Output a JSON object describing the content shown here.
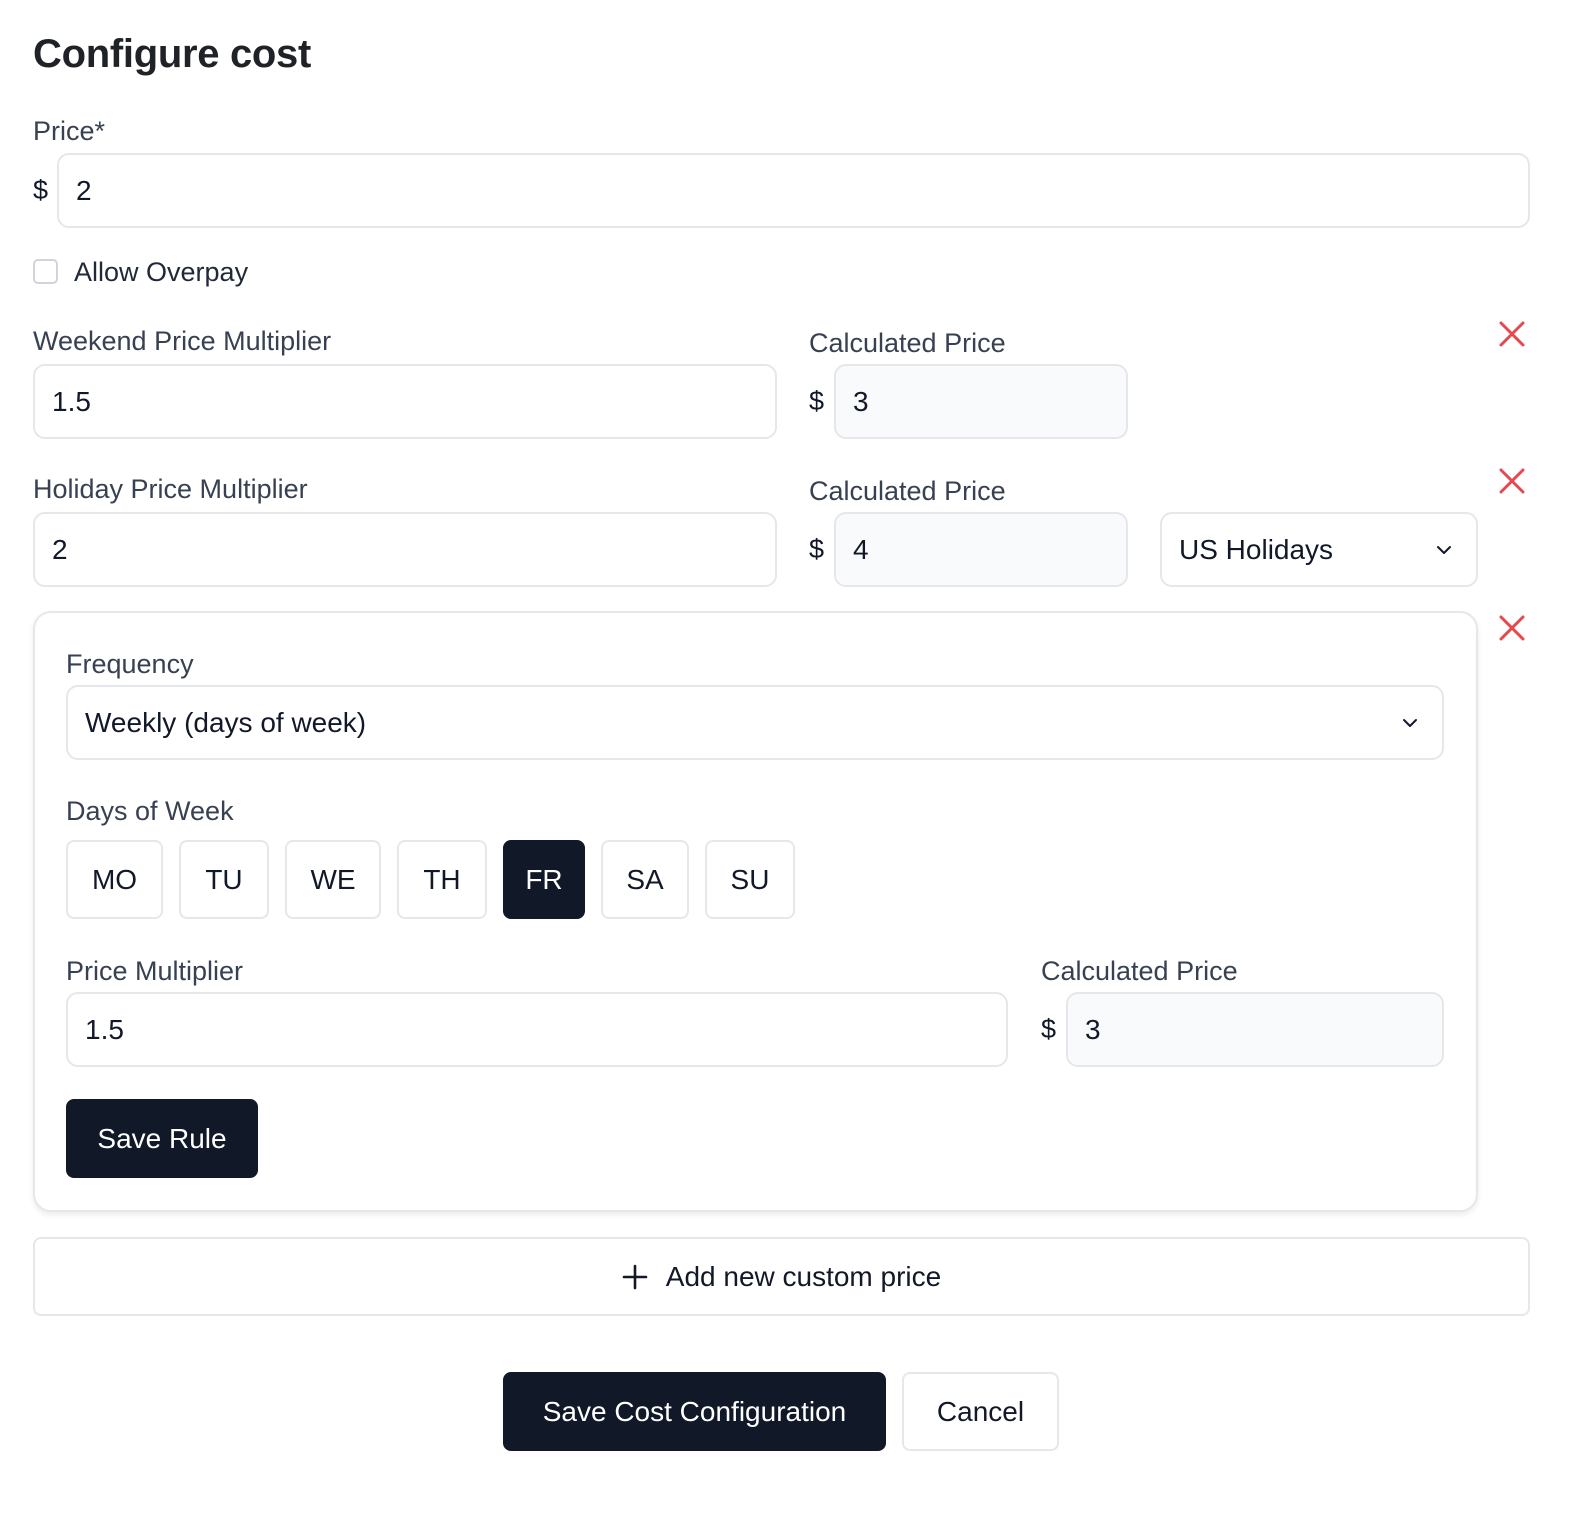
{
  "title": "Configure cost",
  "price": {
    "label": "Price*",
    "currency": "$",
    "value": "2"
  },
  "allow_overpay": {
    "label": "Allow Overpay",
    "checked": false
  },
  "weekend": {
    "label": "Weekend Price Multiplier",
    "value": "1.5",
    "calc_label": "Calculated Price",
    "currency": "$",
    "calc_value": "3"
  },
  "holiday": {
    "label": "Holiday Price Multiplier",
    "value": "2",
    "calc_label": "Calculated Price",
    "currency": "$",
    "calc_value": "4",
    "calendar": "US Holidays"
  },
  "rule": {
    "frequency_label": "Frequency",
    "frequency_value": "Weekly (days of week)",
    "days_label": "Days of Week",
    "days": [
      {
        "label": "MO",
        "selected": false
      },
      {
        "label": "TU",
        "selected": false
      },
      {
        "label": "WE",
        "selected": false
      },
      {
        "label": "TH",
        "selected": false
      },
      {
        "label": "FR",
        "selected": true
      },
      {
        "label": "SA",
        "selected": false
      },
      {
        "label": "SU",
        "selected": false
      }
    ],
    "multiplier_label": "Price Multiplier",
    "multiplier_value": "1.5",
    "calc_label": "Calculated Price",
    "currency": "$",
    "calc_value": "3",
    "save_label": "Save Rule"
  },
  "add_custom_price_label": "Add new custom price",
  "footer": {
    "save_label": "Save Cost Configuration",
    "cancel_label": "Cancel"
  },
  "colors": {
    "primary": "#111827",
    "remove": "#e5484d",
    "border": "#e5e7eb",
    "readonly_bg": "#f9fafb"
  }
}
